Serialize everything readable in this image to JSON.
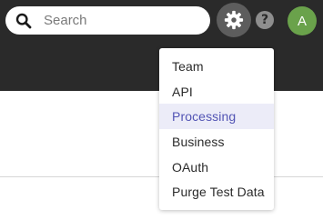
{
  "search": {
    "placeholder": "Search",
    "icon": "search-icon"
  },
  "header": {
    "settings_icon": "gear-icon",
    "help_icon": "help-icon",
    "help_label": "?",
    "avatar_initial": "A",
    "avatar_color": "#6aa24b"
  },
  "settings_menu": {
    "active_item": "Processing",
    "items": [
      {
        "label": "Team"
      },
      {
        "label": "API"
      },
      {
        "label": "Processing"
      },
      {
        "label": "Business"
      },
      {
        "label": "OAuth"
      },
      {
        "label": "Purge Test Data"
      }
    ]
  },
  "colors": {
    "topbar": "#2a2a2a",
    "active_text": "#5254b4",
    "active_bg": "#ececf8"
  }
}
